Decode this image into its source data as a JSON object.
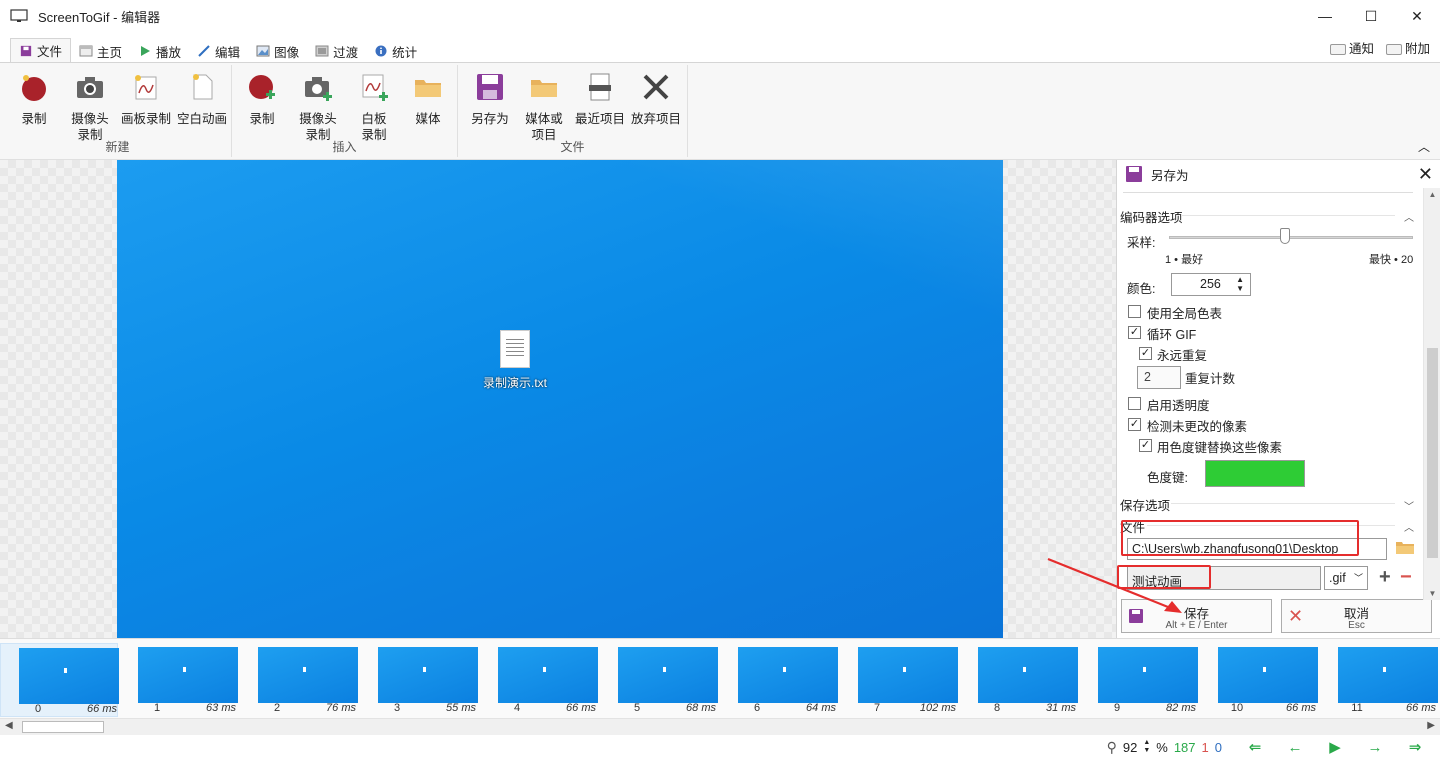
{
  "window": {
    "title": "ScreenToGif - 编辑器"
  },
  "tabs": [
    {
      "label": "文件"
    },
    {
      "label": "主页"
    },
    {
      "label": "播放"
    },
    {
      "label": "编辑"
    },
    {
      "label": "图像"
    },
    {
      "label": "过渡"
    },
    {
      "label": "统计"
    }
  ],
  "top_right": {
    "notify": "通知",
    "extras": "附加"
  },
  "ribbon": {
    "new_group": "新建",
    "insert_group": "插入",
    "file_group": "文件",
    "new": [
      {
        "l1": "录制",
        "l2": ""
      },
      {
        "l1": "摄像头",
        "l2": "录制"
      },
      {
        "l1": "画板录制",
        "l2": ""
      },
      {
        "l1": "空白动画",
        "l2": ""
      }
    ],
    "insert": [
      {
        "l1": "录制",
        "l2": ""
      },
      {
        "l1": "摄像头",
        "l2": "录制"
      },
      {
        "l1": "白板",
        "l2": "录制"
      },
      {
        "l1": "媒体",
        "l2": ""
      }
    ],
    "file": [
      {
        "l1": "另存为",
        "l2": ""
      },
      {
        "l1": "媒体或",
        "l2": "项目"
      },
      {
        "l1": "最近项目",
        "l2": ""
      },
      {
        "l1": "放弃项目",
        "l2": ""
      }
    ]
  },
  "canvas": {
    "file_label": "录制演示.txt"
  },
  "panel": {
    "title": "另存为",
    "encoder_section": "编码器选项",
    "sampling_label": "采样:",
    "sampling_min": "1 • 最好",
    "sampling_max": "最快 • 20",
    "sampling_value": 11,
    "colors_label": "颜色:",
    "colors_value": "256",
    "global_palette": "使用全局色表",
    "loop_gif": "循环 GIF",
    "repeat_forever": "永远重复",
    "repeat_count_value": "2",
    "repeat_count_label": "重复计数",
    "enable_transparency": "启用透明度",
    "detect_unchanged": "检测未更改的像素",
    "replace_with_chroma": "用色度键替换这些像素",
    "chroma_key_label": "色度键:",
    "chroma_color": "#2ECC35",
    "save_section": "保存选项",
    "file_section": "文件",
    "path_value": "C:\\Users\\wb.zhangfusong01\\Desktop",
    "filename_value": "测试动画",
    "extension_value": ".gif",
    "save_label": "保存",
    "save_shortcut": "Alt + E / Enter",
    "cancel_label": "取消",
    "cancel_shortcut": "Esc",
    "checked": {
      "global_palette": false,
      "loop_gif": true,
      "repeat_forever": true,
      "enable_transparency": false,
      "detect_unchanged": true,
      "replace_with_chroma": true
    }
  },
  "frames": [
    {
      "num": "0",
      "ms": "66 ms"
    },
    {
      "num": "1",
      "ms": "63 ms"
    },
    {
      "num": "2",
      "ms": "76 ms"
    },
    {
      "num": "3",
      "ms": "55 ms"
    },
    {
      "num": "4",
      "ms": "66 ms"
    },
    {
      "num": "5",
      "ms": "68 ms"
    },
    {
      "num": "6",
      "ms": "64 ms"
    },
    {
      "num": "7",
      "ms": "102 ms"
    },
    {
      "num": "8",
      "ms": "31 ms"
    },
    {
      "num": "9",
      "ms": "82 ms"
    },
    {
      "num": "10",
      "ms": "66 ms"
    },
    {
      "num": "11",
      "ms": "66 ms"
    }
  ],
  "status": {
    "zoom": "92",
    "zoom_unit": "%",
    "frame_count": "187",
    "selected": "1",
    "current": "0"
  },
  "colors": {
    "accent_green": "#2AA94A",
    "red_annotation": "#E52D2D",
    "selection": "#E5F1FB"
  }
}
